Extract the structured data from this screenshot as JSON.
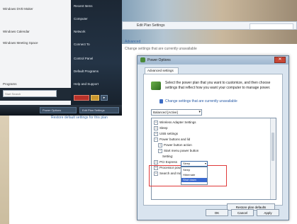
{
  "background": {
    "address_path": "Edit Plan Settings",
    "link_left": "Advanced",
    "link_subtitle": "Change settings that are currently unavailable",
    "footer_link": "Restore default settings for this plan"
  },
  "taskbar": {
    "buttons": [
      "Power Options",
      "Edit Plan Settings"
    ]
  },
  "start_menu": {
    "left_items": [
      "Windows DVD Maker",
      "Windows Calendar",
      "Windows Meeting Space",
      "Programs"
    ],
    "search_placeholder": "Start Search",
    "right_items": [
      "Recent Items",
      "Computer",
      "Network",
      "Connect To",
      "Control Panel",
      "Default Programs",
      "Help and Support"
    ]
  },
  "dialog": {
    "title": "Power Options",
    "close_glyph": "✕",
    "tab": "Advanced settings",
    "description": "Select the power plan that you want to customize, and then choose settings that reflect how you want your computer to manage power.",
    "change_link": "Change settings that are currently unavailable",
    "plan_select": "Balanced [Active]",
    "tree": [
      {
        "pm": "+",
        "label": "Wireless Adapter Settings",
        "indent": 0
      },
      {
        "pm": "+",
        "label": "Sleep",
        "indent": 0
      },
      {
        "pm": "+",
        "label": "USB settings",
        "indent": 0
      },
      {
        "pm": "−",
        "label": "Power buttons and lid",
        "indent": 0
      },
      {
        "pm": "+",
        "label": "Power button action",
        "indent": 1
      },
      {
        "pm": "−",
        "label": "Start menu power button",
        "indent": 1
      },
      {
        "pm": "",
        "label": "Setting:",
        "indent": 2
      },
      {
        "pm": "+",
        "label": "PCI Express",
        "indent": 0
      },
      {
        "pm": "+",
        "label": "Processor power management",
        "indent": 0
      },
      {
        "pm": "+",
        "label": "Search and Indexing",
        "indent": 0
      }
    ],
    "setting_value": "Sleep",
    "dropdown_options": [
      "Sleep",
      "Hibernate",
      "Shut down"
    ],
    "dropdown_selected": 2,
    "restore_button": "Restore plan defaults",
    "ok": "OK",
    "cancel": "Cancel",
    "apply": "Apply"
  }
}
